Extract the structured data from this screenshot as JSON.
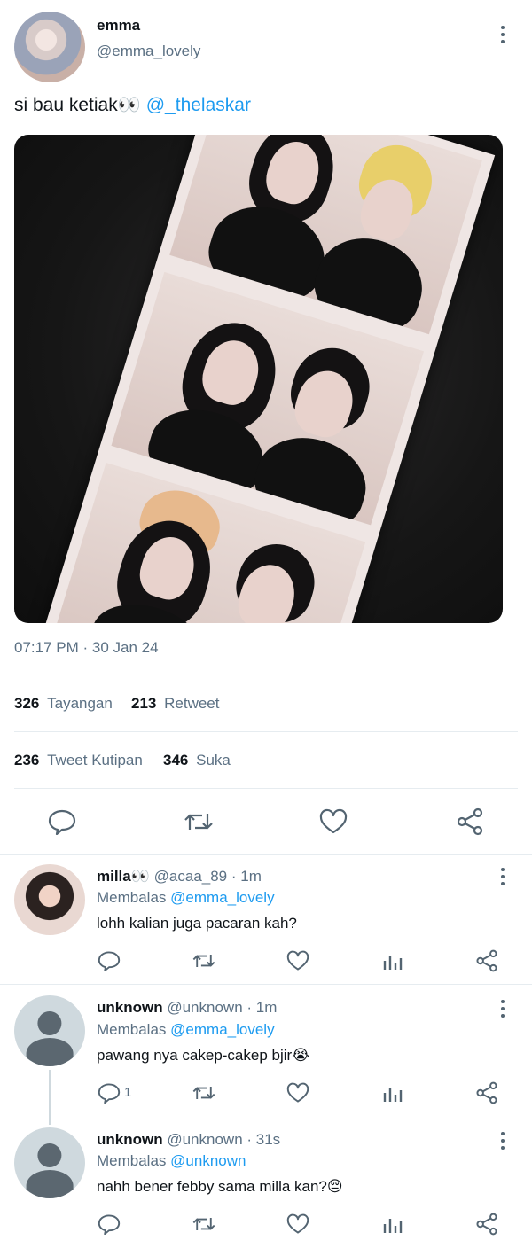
{
  "tweet": {
    "author_name": "emma",
    "author_handle": "@emma_lovely",
    "text": "si bau ketiak👀",
    "mention": "@_thelaskar",
    "timestamp": "07:17 PM · 30 Jan 24",
    "stats": {
      "views_count": "326",
      "views_label": "Tayangan",
      "retweets_count": "213",
      "retweets_label": "Retweet",
      "quotes_count": "236",
      "quotes_label": "Tweet Kutipan",
      "likes_count": "346",
      "likes_label": "Suka"
    }
  },
  "replies": [
    {
      "name": "milla👀",
      "handle_time": "@acaa_89 · 1m",
      "replying_label": "Membalas",
      "replying_to": "@emma_lovely",
      "text": "lohh kalian juga pacaran kah?",
      "reply_count": ""
    },
    {
      "name": "unknown",
      "handle_time": "@unknown · 1m",
      "replying_label": "Membalas",
      "replying_to": "@emma_lovely",
      "text": "pawang nya cakep-cakep bjir😭",
      "reply_count": "1"
    },
    {
      "name": "unknown",
      "handle_time": "@unknown · 31s",
      "replying_label": "Membalas",
      "replying_to": "@unknown",
      "text": "nahh bener febby sama milla kan?😔",
      "reply_count": ""
    }
  ],
  "colors": {
    "accent": "#1d9bf0",
    "muted": "#5b7083",
    "text": "#0f1419",
    "divider": "#e6ecf0"
  },
  "icons": [
    "more-icon",
    "reply-icon",
    "retweet-icon",
    "like-icon",
    "share-icon",
    "analytics-icon"
  ]
}
